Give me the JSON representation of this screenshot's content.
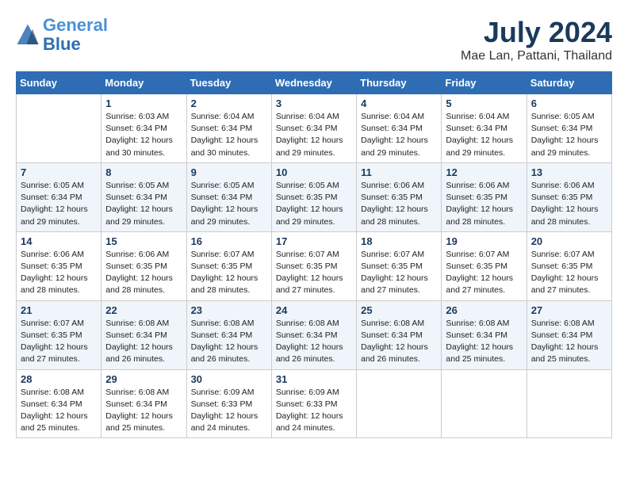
{
  "header": {
    "logo_line1": "General",
    "logo_line2": "Blue",
    "month_year": "July 2024",
    "location": "Mae Lan, Pattani, Thailand"
  },
  "days_of_week": [
    "Sunday",
    "Monday",
    "Tuesday",
    "Wednesday",
    "Thursday",
    "Friday",
    "Saturday"
  ],
  "weeks": [
    [
      {
        "day": "",
        "info": ""
      },
      {
        "day": "1",
        "info": "Sunrise: 6:03 AM\nSunset: 6:34 PM\nDaylight: 12 hours\nand 30 minutes."
      },
      {
        "day": "2",
        "info": "Sunrise: 6:04 AM\nSunset: 6:34 PM\nDaylight: 12 hours\nand 30 minutes."
      },
      {
        "day": "3",
        "info": "Sunrise: 6:04 AM\nSunset: 6:34 PM\nDaylight: 12 hours\nand 29 minutes."
      },
      {
        "day": "4",
        "info": "Sunrise: 6:04 AM\nSunset: 6:34 PM\nDaylight: 12 hours\nand 29 minutes."
      },
      {
        "day": "5",
        "info": "Sunrise: 6:04 AM\nSunset: 6:34 PM\nDaylight: 12 hours\nand 29 minutes."
      },
      {
        "day": "6",
        "info": "Sunrise: 6:05 AM\nSunset: 6:34 PM\nDaylight: 12 hours\nand 29 minutes."
      }
    ],
    [
      {
        "day": "7",
        "info": "Sunrise: 6:05 AM\nSunset: 6:34 PM\nDaylight: 12 hours\nand 29 minutes."
      },
      {
        "day": "8",
        "info": "Sunrise: 6:05 AM\nSunset: 6:34 PM\nDaylight: 12 hours\nand 29 minutes."
      },
      {
        "day": "9",
        "info": "Sunrise: 6:05 AM\nSunset: 6:34 PM\nDaylight: 12 hours\nand 29 minutes."
      },
      {
        "day": "10",
        "info": "Sunrise: 6:05 AM\nSunset: 6:35 PM\nDaylight: 12 hours\nand 29 minutes."
      },
      {
        "day": "11",
        "info": "Sunrise: 6:06 AM\nSunset: 6:35 PM\nDaylight: 12 hours\nand 28 minutes."
      },
      {
        "day": "12",
        "info": "Sunrise: 6:06 AM\nSunset: 6:35 PM\nDaylight: 12 hours\nand 28 minutes."
      },
      {
        "day": "13",
        "info": "Sunrise: 6:06 AM\nSunset: 6:35 PM\nDaylight: 12 hours\nand 28 minutes."
      }
    ],
    [
      {
        "day": "14",
        "info": "Sunrise: 6:06 AM\nSunset: 6:35 PM\nDaylight: 12 hours\nand 28 minutes."
      },
      {
        "day": "15",
        "info": "Sunrise: 6:06 AM\nSunset: 6:35 PM\nDaylight: 12 hours\nand 28 minutes."
      },
      {
        "day": "16",
        "info": "Sunrise: 6:07 AM\nSunset: 6:35 PM\nDaylight: 12 hours\nand 28 minutes."
      },
      {
        "day": "17",
        "info": "Sunrise: 6:07 AM\nSunset: 6:35 PM\nDaylight: 12 hours\nand 27 minutes."
      },
      {
        "day": "18",
        "info": "Sunrise: 6:07 AM\nSunset: 6:35 PM\nDaylight: 12 hours\nand 27 minutes."
      },
      {
        "day": "19",
        "info": "Sunrise: 6:07 AM\nSunset: 6:35 PM\nDaylight: 12 hours\nand 27 minutes."
      },
      {
        "day": "20",
        "info": "Sunrise: 6:07 AM\nSunset: 6:35 PM\nDaylight: 12 hours\nand 27 minutes."
      }
    ],
    [
      {
        "day": "21",
        "info": "Sunrise: 6:07 AM\nSunset: 6:35 PM\nDaylight: 12 hours\nand 27 minutes."
      },
      {
        "day": "22",
        "info": "Sunrise: 6:08 AM\nSunset: 6:34 PM\nDaylight: 12 hours\nand 26 minutes."
      },
      {
        "day": "23",
        "info": "Sunrise: 6:08 AM\nSunset: 6:34 PM\nDaylight: 12 hours\nand 26 minutes."
      },
      {
        "day": "24",
        "info": "Sunrise: 6:08 AM\nSunset: 6:34 PM\nDaylight: 12 hours\nand 26 minutes."
      },
      {
        "day": "25",
        "info": "Sunrise: 6:08 AM\nSunset: 6:34 PM\nDaylight: 12 hours\nand 26 minutes."
      },
      {
        "day": "26",
        "info": "Sunrise: 6:08 AM\nSunset: 6:34 PM\nDaylight: 12 hours\nand 25 minutes."
      },
      {
        "day": "27",
        "info": "Sunrise: 6:08 AM\nSunset: 6:34 PM\nDaylight: 12 hours\nand 25 minutes."
      }
    ],
    [
      {
        "day": "28",
        "info": "Sunrise: 6:08 AM\nSunset: 6:34 PM\nDaylight: 12 hours\nand 25 minutes."
      },
      {
        "day": "29",
        "info": "Sunrise: 6:08 AM\nSunset: 6:34 PM\nDaylight: 12 hours\nand 25 minutes."
      },
      {
        "day": "30",
        "info": "Sunrise: 6:09 AM\nSunset: 6:33 PM\nDaylight: 12 hours\nand 24 minutes."
      },
      {
        "day": "31",
        "info": "Sunrise: 6:09 AM\nSunset: 6:33 PM\nDaylight: 12 hours\nand 24 minutes."
      },
      {
        "day": "",
        "info": ""
      },
      {
        "day": "",
        "info": ""
      },
      {
        "day": "",
        "info": ""
      }
    ]
  ]
}
